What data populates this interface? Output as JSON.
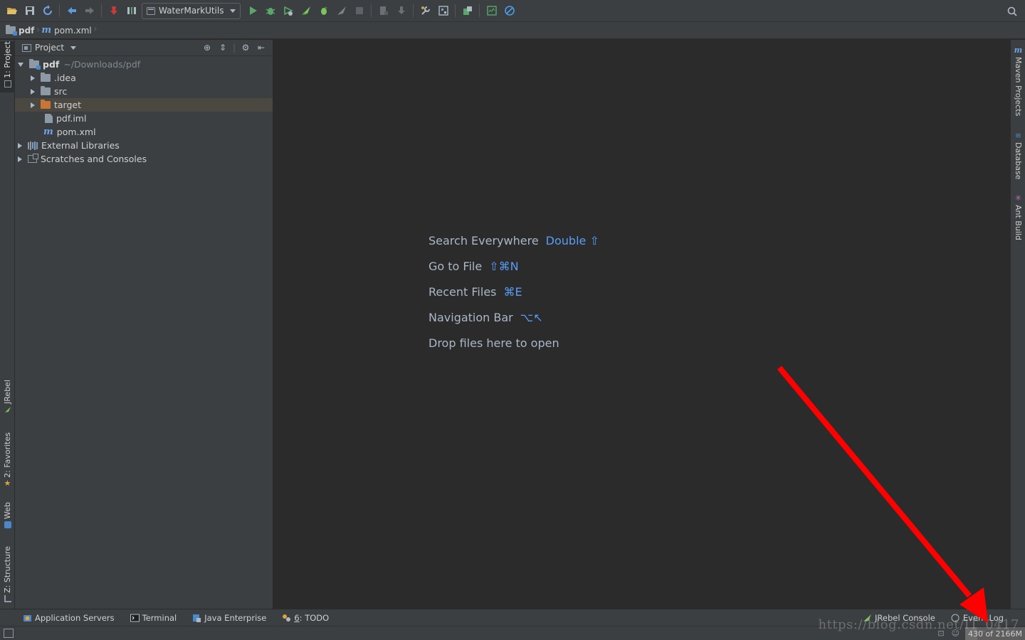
{
  "toolbar": {
    "run_config": "WaterMarkUtils",
    "icons": [
      "open-icon",
      "save-icon",
      "sync-icon",
      "back-icon",
      "forward-icon",
      "build-icon",
      "make-icon",
      "run-icon",
      "debug-icon",
      "coverage-icon",
      "jrebel-run-icon",
      "jrebel-debug-icon",
      "profile-icon",
      "stop-icon",
      "sdk-icon",
      "download-icon",
      "settings-icon",
      "project-structure-icon",
      "plugin-icon",
      "vcs-icon",
      "power-save-icon",
      "search-icon"
    ]
  },
  "navbar": {
    "crumbs": [
      "pdf",
      "pom.xml"
    ]
  },
  "left_stripe": {
    "tabs": [
      "1: Project",
      "JRebel",
      "2: Favorites",
      "Web",
      "Z: Structure"
    ]
  },
  "right_stripe": {
    "tabs": [
      "Maven Projects",
      "Database",
      "Ant Build"
    ]
  },
  "project_panel": {
    "title": "Project",
    "tree": [
      {
        "label": "pdf",
        "path": "~/Downloads/pdf"
      },
      {
        "label": ".idea"
      },
      {
        "label": "src"
      },
      {
        "label": "target"
      },
      {
        "label": "pdf.iml"
      },
      {
        "label": "pom.xml"
      },
      {
        "label": "External Libraries"
      },
      {
        "label": "Scratches and Consoles"
      }
    ]
  },
  "editor": {
    "hints": [
      {
        "text": "Search Everywhere",
        "key": "Double ⇧"
      },
      {
        "text": "Go to File",
        "key": "⇧⌘N"
      },
      {
        "text": "Recent Files",
        "key": "⌘E"
      },
      {
        "text": "Navigation Bar",
        "key": "⌥↖"
      },
      {
        "text": "Drop files here to open",
        "key": ""
      }
    ]
  },
  "bottom_bar": {
    "tabs": [
      {
        "label": "Application Servers"
      },
      {
        "label": "Terminal"
      },
      {
        "label": "Java Enterprise"
      },
      {
        "mnemonic": "6",
        "label": ": TODO"
      }
    ],
    "right_tabs": [
      {
        "label": "JRebel Console"
      },
      {
        "label": "Event Log"
      }
    ]
  },
  "status_bar": {
    "memory": "430 of 2166M",
    "memory_fraction": 0.2
  },
  "watermark": "https://blog.csdn.net/IT_0417",
  "colors": {
    "accent": "#589df6",
    "selected_folder": "#c87536",
    "annotation_arrow": "#ff0000"
  }
}
